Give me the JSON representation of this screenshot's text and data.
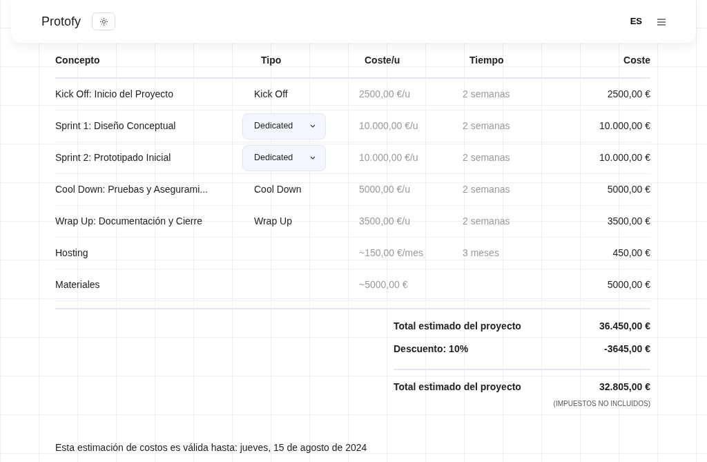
{
  "header": {
    "brand": "Protofy",
    "language": "ES"
  },
  "table": {
    "columns": [
      "Concepto",
      "Tipo",
      "Coste/u",
      "Tiempo",
      "Coste"
    ],
    "rows": [
      {
        "concept": "Kick Off: Inicio del Proyecto",
        "type": {
          "kind": "text",
          "label": "Kick Off"
        },
        "unit_cost": "2500,00 €/u",
        "time": "2 semanas",
        "cost": "2500,00 €"
      },
      {
        "concept": "Sprint 1: Diseño Conceptual",
        "type": {
          "kind": "select",
          "label": "Dedicated"
        },
        "unit_cost": "10.000,00 €/u",
        "time": "2 semanas",
        "cost": "10.000,00 €"
      },
      {
        "concept": "Sprint 2: Prototipado Inicial",
        "type": {
          "kind": "select",
          "label": "Dedicated"
        },
        "unit_cost": "10.000,00 €/u",
        "time": "2 semanas",
        "cost": "10.000,00 €"
      },
      {
        "concept": "Cool Down: Pruebas y Asegurami...",
        "type": {
          "kind": "text",
          "label": "Cool Down"
        },
        "unit_cost": "5000,00 €/u",
        "time": "2 semanas",
        "cost": "5000,00 €"
      },
      {
        "concept": "Wrap Up: Documentación y Cierre",
        "type": {
          "kind": "text",
          "label": "Wrap Up"
        },
        "unit_cost": "3500,00 €/u",
        "time": "2 semanas",
        "cost": "3500,00 €"
      },
      {
        "concept": "Hosting",
        "unit_cost": "~150,00 €/mes",
        "time": "3 meses",
        "cost": "450,00 €"
      },
      {
        "concept": "Materiales",
        "unit_cost": "~5000,00 €",
        "cost": "5000,00 €"
      }
    ]
  },
  "totals": [
    {
      "label": "Total estimado del proyecto",
      "value": "36.450,00 €"
    },
    {
      "label": "Descuento: 10%",
      "value": "-3645,00 €"
    },
    {
      "label": "Total estimado del proyecto",
      "value": "32.805,00 €"
    }
  ],
  "tax_note": "(IMPUESTOS NO INCLUIDOS)",
  "validity": "Esta estimación de costos es válida hasta: jueves, 15 de agosto de 2024"
}
